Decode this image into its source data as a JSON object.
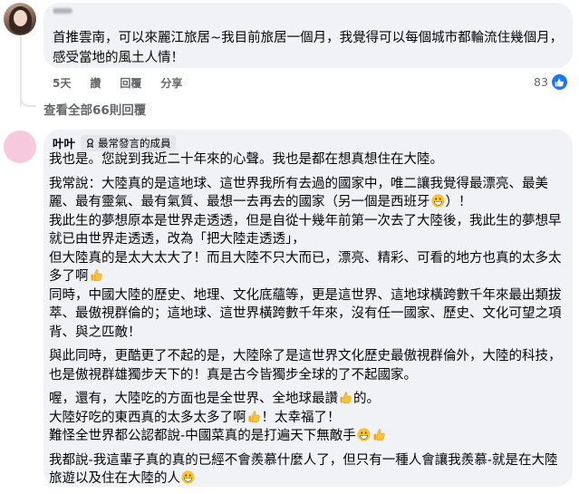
{
  "comment1": {
    "text": "首推雲南，可以來麗江旅居~我目前旅居一個月，我覺得可以每個城市都輪流住幾個月，感受當地的風土人情！",
    "time": "5天",
    "like_label": "讚",
    "reply_label": "回覆",
    "share_label": "分享",
    "reaction_count": "83"
  },
  "view_all_replies": "查看全部66則回覆",
  "comment2": {
    "author": "叶叶",
    "badge": "最常發言的成員",
    "paragraphs": [
      "我也是。您說到我近二十年來的心聲。我也是都在想真想住在大陸。",
      "我常說：大陸真的是這地球、這世界我所有去過的國家中，唯二讓我覺得最漂亮、最美麗、最有靈氣、最有氣質、最想一去再去的國家（另一個是西班牙",
      "）！",
      "我此生的夢想原本是世界走透透，但是自從十幾年前第一次去了大陸後，我此生的夢想早就已由世界走透透，改為「把大陸走透透」，",
      "但大陸真的是太大太大了！而且大陸不只大而已，漂亮、精彩、可看的地方也真的太多太多了啊",
      "同時，中國大陸的歷史、地理、文化底蘊等，更是這世界、這地球橫跨數千年來最出類拔萃、最傲視群倫的；這地球、這世界橫跨數千年來，沒有任一國家、歷史、文化可望之項背、與之匹敵！",
      "與此同時，更酷更了不起的是，大陸除了是這世界文化歷史最傲視群倫外，大陸的科技，也是傲視群雄獨步天下的！真是古今皆獨步全球的了不起國家。",
      "喔，還有，大陸吃的方面也是全世界、全地球最讚",
      "的。",
      "大陸好吃的東西真的太多太多了啊",
      "！太幸福了！",
      "難怪全世界都公認都說-中國菜真的是打遍天下無敵手",
      "我都說-我這輩子真的真的已經不會羨慕什麼人了，但只有一種人會讓我羨慕-就是在大陸旅遊以及住在大陸的人"
    ]
  },
  "colors": {
    "bubble": "#f0f2f5",
    "meta": "#65676b",
    "like_blue": "#1877f2"
  },
  "icons": [
    "like-icon",
    "grin-emoji",
    "thumbs-up-emoji",
    "member-badge-icon"
  ]
}
